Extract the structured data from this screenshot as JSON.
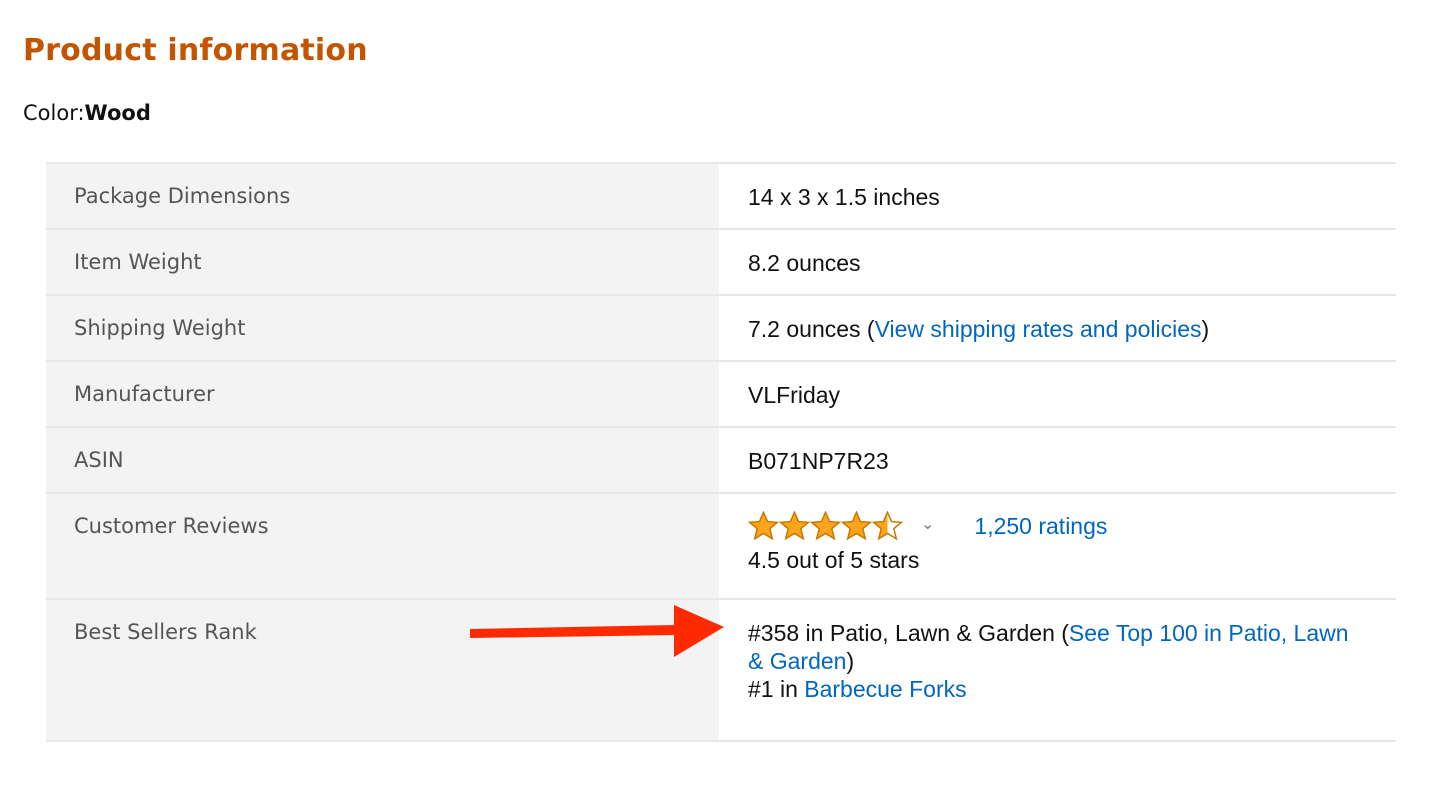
{
  "page": {
    "title": "Product information",
    "color_label": "Color:",
    "color_value": "Wood"
  },
  "rows": [
    {
      "label": "Package Dimensions",
      "value": "14 x 3 x 1.5 inches"
    },
    {
      "label": "Item Weight",
      "value": "8.2 ounces"
    },
    {
      "label": "Shipping Weight",
      "value": "7.2 ounces (",
      "link": "View shipping rates and policies",
      "suffix": ")"
    },
    {
      "label": "Manufacturer",
      "value": "VLFriday"
    },
    {
      "label": "ASIN",
      "value": "B071NP7R23"
    },
    {
      "label": "Customer Reviews",
      "rating": 4.5,
      "rating_max": 5,
      "ratings_link": "1,250 ratings",
      "rating_text": "4.5 out of 5 stars"
    },
    {
      "label": "Best Sellers Rank",
      "rank1_text": "#358 in Patio, Lawn & Garden (",
      "rank1_link": "See Top 100 in Patio, Lawn & Garden",
      "rank1_suffix": ")",
      "rank2_text": "#1 in ",
      "rank2_link": "Barbecue Forks"
    }
  ],
  "colors": {
    "title": "#c45500",
    "link": "#0066c0",
    "star_fill": "#ffa41c",
    "annotation_arrow": "#ff2a00"
  },
  "annotation": {
    "type": "arrow",
    "points_to": "Best Sellers Rank value"
  }
}
